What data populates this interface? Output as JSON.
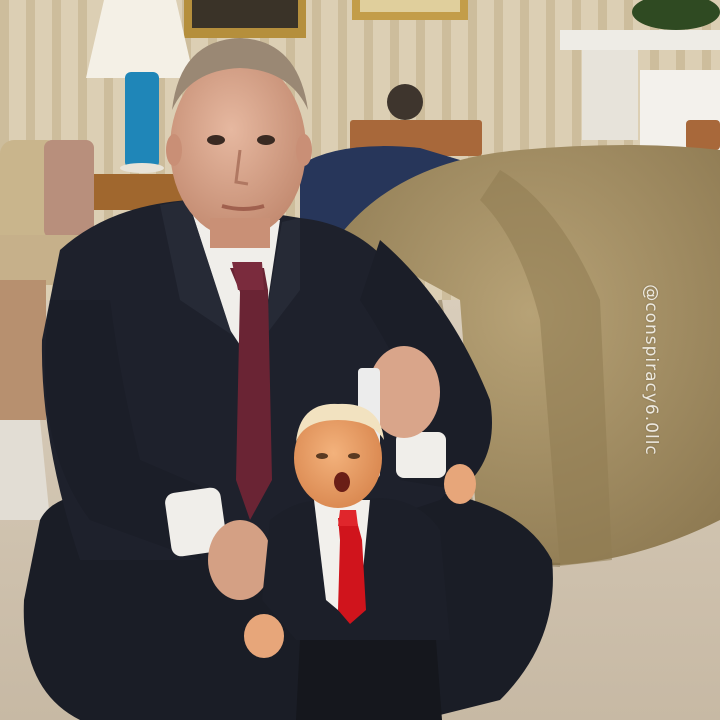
{
  "watermark": {
    "text": "@conspiracy6.0llc"
  },
  "colors": {
    "wall": "#d8cbb0",
    "wall_stripe": "#c9b998",
    "carpet": "#d2c5b2",
    "sofa": "#a89468",
    "sofa_shadow": "#7c6a46",
    "suit_dark": "#1c1f29",
    "shirt_white": "#f0eeea",
    "tie_burgundy": "#6a2434",
    "tie_red": "#d0141c",
    "skin": "#d9a58a",
    "lamp_blue": "#1f86b8",
    "lamp_shade": "#f4f0e6",
    "watermark": "#f4f1ea"
  },
  "icons": [
    "watermark-text"
  ]
}
